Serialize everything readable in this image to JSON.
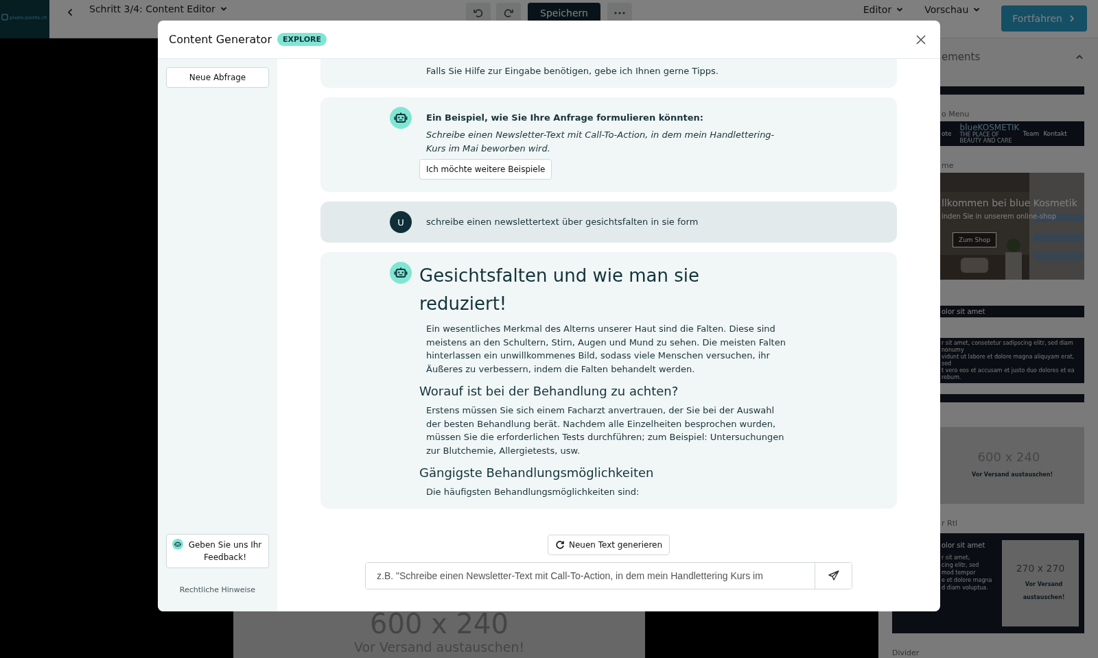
{
  "top_bar": {
    "logo": "pixels-points.ch",
    "step": "Schritt 3/4: Content Editor",
    "save": "Speichern",
    "editor": "Editor",
    "preview": "Vorschau",
    "continue": "Fortfahren"
  },
  "canvas": {
    "size": "600 x 240",
    "note": "Vor Versand austauschen!"
  },
  "elements_panel": {
    "title": "ements",
    "items": [
      {
        "kind": "bar"
      },
      {
        "kind": "label",
        "text": "o Menu"
      },
      {
        "kind": "menu",
        "links": [
          "ote",
          "Team",
          "Kontakt"
        ],
        "logo": "blueKOSMETIK",
        "tagline": "THE PLACE OF BEAUTY AND CARE"
      },
      {
        "kind": "label",
        "text": "me"
      },
      {
        "kind": "hero",
        "title": "llkommen bei blue Kosmetik",
        "subtitle": "inden Sie in unserem online-shop",
        "button": "Zum Shop"
      },
      {
        "kind": "heading_bar",
        "text": "olor sit amet"
      },
      {
        "kind": "text_block",
        "lines": [
          "r sit amet, consetetur sadipscing elitr, sed diam nonumy",
          "vidunt ut labore et dolore magna aliquyam erat, sed",
          "t vero eos et accusam et justo duo dolores et ea rebum."
        ]
      },
      {
        "kind": "bar"
      },
      {
        "kind": "placeholder",
        "size": "600 x 240",
        "note": "Vor Versand austauschen!"
      },
      {
        "kind": "label",
        "text": "r Rtl"
      },
      {
        "kind": "image_text",
        "heading": "olor sit amet",
        "lines": [
          "r sit amet,",
          "cing elitr, sed",
          "mod tempor",
          "e et dolore magna",
          "d diam voluptua."
        ],
        "size": "270 x 270",
        "note": "Vor Versand austauschen!"
      },
      {
        "kind": "label_full",
        "text": "Divider"
      }
    ]
  },
  "modal": {
    "title": "Content Generator",
    "badge": "EXPLORE",
    "new_query": "Neue Abfrage",
    "feedback": "Geben Sie uns Ihr Feedback!",
    "legal": "Rechtliche Hinweise",
    "messages": [
      {
        "kind": "bot",
        "clipped_top": true,
        "blocks": [
          {
            "kind": "p",
            "text": "Falls Sie Hilfe zur Eingabe benötigen, gebe ich Ihnen gerne Tipps."
          }
        ]
      },
      {
        "kind": "bot",
        "clipped_top": false,
        "blocks": [
          {
            "kind": "bold",
            "text": "Ein Beispiel, wie Sie Ihre Anfrage formulieren könnten:"
          },
          {
            "kind": "italic",
            "text": "Schreibe einen Newsletter-Text mit Call-To-Action, in dem mein Handlettering-Kurs im Mai beworben wird."
          },
          {
            "kind": "button",
            "text": "Ich möchte weitere Beispiele"
          }
        ]
      },
      {
        "kind": "user",
        "initial": "U",
        "text": "schreibe einen newslettertext über gesichtsfalten in sie form"
      },
      {
        "kind": "bot",
        "clipped_top": false,
        "blocks": [
          {
            "kind": "h2",
            "text": "Gesichtsfalten und wie man sie reduziert!"
          },
          {
            "kind": "p",
            "text": "Ein wesentliches Merkmal des Alterns unserer Haut sind die Falten. Diese sind meistens an den Schultern, Stirn, Augen und Mund zu sehen. Die meisten Falten hinterlassen ein unwillkommenes Bild, sodass viele Menschen versuchen, ihr Äußeres zu verbessern, indem die Falten behandelt werden."
          },
          {
            "kind": "h3",
            "text": "Worauf ist bei der Behandlung zu achten?"
          },
          {
            "kind": "p",
            "text": "Erstens müssen Sie sich einem Facharzt anvertrauen, der Sie bei der Auswahl der besten Behandlung berät. Nachdem alle Einzelheiten besprochen wurden, müssen Sie die erforderlichen Tests durchführen; zum Beispiel: Untersuchungen zur Blutchemie, Allergietests, usw."
          },
          {
            "kind": "h3",
            "text": "Gängigste Behandlungsmöglichkeiten"
          },
          {
            "kind": "p",
            "text": "Die häufigsten Behandlungsmöglichkeiten sind:"
          }
        ]
      }
    ],
    "regenerate": "Neuen Text generieren",
    "input_placeholder": "z.B. \"Schreibe einen Newsletter-Text mit Call-To-Action, in dem mein Handlettering Kurs im"
  }
}
